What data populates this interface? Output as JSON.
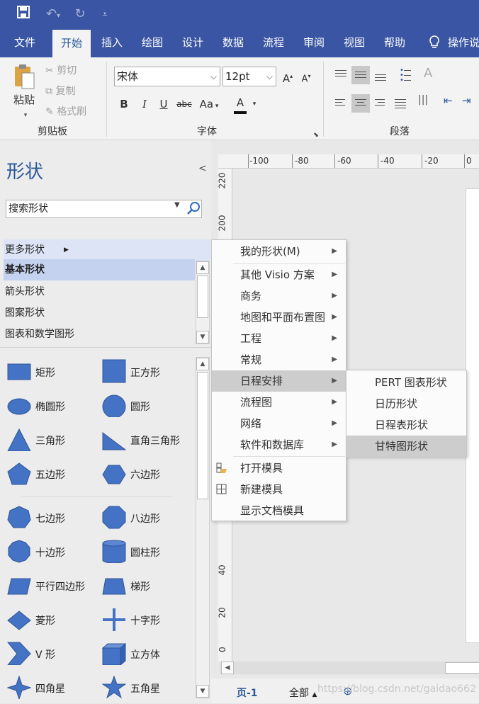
{
  "quick_access": {
    "save_icon": "save-icon",
    "undo_icon": "undo-icon",
    "redo_icon": "redo-icon",
    "customize_icon": "customize-icon"
  },
  "tabs": [
    {
      "label": "文件"
    },
    {
      "label": "开始"
    },
    {
      "label": "插入"
    },
    {
      "label": "绘图"
    },
    {
      "label": "设计"
    },
    {
      "label": "数据"
    },
    {
      "label": "流程"
    },
    {
      "label": "审阅"
    },
    {
      "label": "视图"
    },
    {
      "label": "帮助"
    },
    {
      "label": "操作说"
    }
  ],
  "ribbon": {
    "clipboard": {
      "group_label": "剪贴板",
      "paste": "粘贴",
      "cut": "剪切",
      "copy": "复制",
      "format_painter": "格式刷"
    },
    "font": {
      "group_label": "字体",
      "font_name": "宋体",
      "font_size": "12pt",
      "bold": "B",
      "italic": "I",
      "underline": "U",
      "strike": "abc",
      "case": "Aa",
      "color_letter": "A",
      "grow": "A",
      "shrink": "A"
    },
    "paragraph": {
      "group_label": "段落"
    }
  },
  "shapes_pane": {
    "title": "形状",
    "search_placeholder": "搜索形状",
    "more_shapes": "更多形状",
    "stencils": [
      {
        "label": "基本形状"
      },
      {
        "label": "箭头形状"
      },
      {
        "label": "图案形状"
      },
      {
        "label": "图表和数学图形"
      }
    ],
    "shapes": [
      {
        "label": "矩形",
        "icon": "rectangle-icon"
      },
      {
        "label": "正方形",
        "icon": "square-icon"
      },
      {
        "label": "椭圆形",
        "icon": "ellipse-icon"
      },
      {
        "label": "圆形",
        "icon": "circle-icon"
      },
      {
        "label": "三角形",
        "icon": "triangle-icon"
      },
      {
        "label": "直角三角形",
        "icon": "right-triangle-icon"
      },
      {
        "label": "五边形",
        "icon": "pentagon-icon"
      },
      {
        "label": "六边形",
        "icon": "hexagon-icon"
      },
      {
        "label": "七边形",
        "icon": "heptagon-icon"
      },
      {
        "label": "八边形",
        "icon": "octagon-icon"
      },
      {
        "label": "十边形",
        "icon": "decagon-icon"
      },
      {
        "label": "圆柱形",
        "icon": "cylinder-icon"
      },
      {
        "label": "平行四边形",
        "icon": "parallelogram-icon"
      },
      {
        "label": "梯形",
        "icon": "trapezoid-icon"
      },
      {
        "label": "菱形",
        "icon": "diamond-icon"
      },
      {
        "label": "十字形",
        "icon": "cross-icon"
      },
      {
        "label": "V 形",
        "icon": "chevron-icon"
      },
      {
        "label": "立方体",
        "icon": "cube-icon"
      },
      {
        "label": "四角星",
        "icon": "star4-icon"
      },
      {
        "label": "五角星",
        "icon": "star5-icon"
      }
    ]
  },
  "more_shapes_menu": {
    "items": [
      {
        "label": "我的形状(M)",
        "has_submenu": true
      },
      {
        "label": "其他 Visio 方案",
        "has_submenu": true
      },
      {
        "label": "商务",
        "has_submenu": true
      },
      {
        "label": "地图和平面布置图",
        "has_submenu": true
      },
      {
        "label": "工程",
        "has_submenu": true
      },
      {
        "label": "常规",
        "has_submenu": true
      },
      {
        "label": "日程安排",
        "has_submenu": true
      },
      {
        "label": "流程图",
        "has_submenu": true
      },
      {
        "label": "网络",
        "has_submenu": true
      },
      {
        "label": "软件和数据库",
        "has_submenu": true
      }
    ],
    "actions": [
      {
        "label": "打开模具",
        "icon": "open-stencil-icon"
      },
      {
        "label": "新建模具",
        "icon": "new-stencil-icon"
      },
      {
        "label": "显示文档模具",
        "icon": ""
      }
    ]
  },
  "schedule_submenu": {
    "items": [
      {
        "label": "PERT 图表形状"
      },
      {
        "label": "日历形状"
      },
      {
        "label": "日程表形状"
      },
      {
        "label": "甘特图形状"
      }
    ]
  },
  "ruler": {
    "top_ticks": [
      "-100",
      "-80",
      "-60",
      "-40",
      "-20",
      "0"
    ],
    "left_ticks": [
      "220",
      "200",
      "40",
      "20",
      "0"
    ]
  },
  "status": {
    "page_tab": "页-1",
    "all_pages": "全部",
    "watermark": "https://blog.csdn.net/gaidao662"
  }
}
